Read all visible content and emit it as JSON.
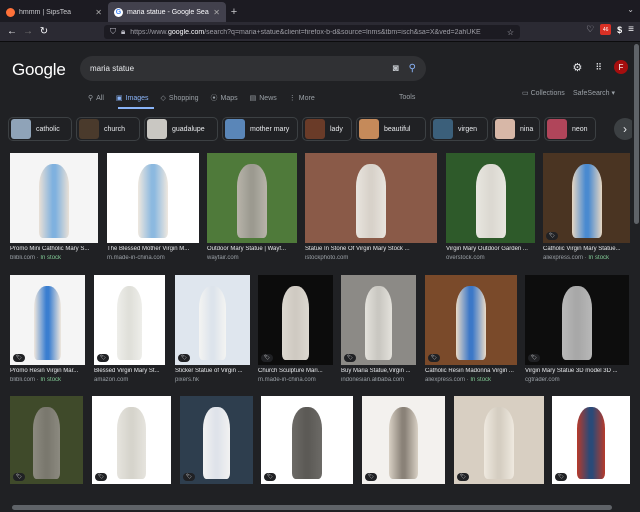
{
  "browser": {
    "tabs": [
      {
        "title": "hmmm | SipsTea",
        "active": false,
        "favicon_color": "#ff7139"
      },
      {
        "title": "maria statue - Google Search",
        "active": true,
        "favicon_color": "#ffffff"
      }
    ],
    "url_prefix": "https://www.",
    "url_domain": "google.com",
    "url_rest": "/search?q=maria+statue&client=firefox-b-d&source=lnms&tbm=isch&sa=X&ved=2ahUKE",
    "new_tab": "+",
    "ext_badge": "46"
  },
  "google": {
    "logo": "Google",
    "search_value": "maria statue",
    "avatar_letter": "F",
    "nav": [
      "All",
      "Images",
      "Shopping",
      "Maps",
      "News",
      "More"
    ],
    "nav_active": 1,
    "tools": "Tools",
    "collections": "Collections",
    "safesearch": "SafeSearch"
  },
  "chips": [
    {
      "label": "catholic",
      "color": "#8fa3b8"
    },
    {
      "label": "church",
      "color": "#4a3a2c"
    },
    {
      "label": "guadalupe",
      "color": "#c9c7c2"
    },
    {
      "label": "mother mary",
      "color": "#5a86b8"
    },
    {
      "label": "lady",
      "color": "#6a3b28"
    },
    {
      "label": "beautiful",
      "color": "#c58a5a"
    },
    {
      "label": "virgen",
      "color": "#3b5f7a"
    },
    {
      "label": "nina",
      "color": "#d7b7a7"
    },
    {
      "label": "neon",
      "color": "#b0455a"
    }
  ],
  "results": [
    {
      "caption": "Promo Mini Catholic Mary S...",
      "source": "blibli.com",
      "stock": "In stock"
    },
    {
      "caption": "The Blessed Mother Virgin M...",
      "source": "m.made-in-china.com"
    },
    {
      "caption": "Outdoor Mary Statue | Wayf...",
      "source": "wayfair.com"
    },
    {
      "caption": "Statue In Stone Of Virgin Mary Stock ...",
      "source": "istockphoto.com"
    },
    {
      "caption": "Virgin Mary Outdoor Garden ...",
      "source": "overstock.com"
    },
    {
      "caption": "Catholic Virgin Mary Statue...",
      "source": "aliexpress.com",
      "stock": "In stock"
    },
    {
      "caption": "Promo Resin Virgin Mar...",
      "source": "blibli.com",
      "stock": "In stock"
    },
    {
      "caption": "Blessed Virgin Mary St...",
      "source": "amazon.com"
    },
    {
      "caption": "Sticker Statue of Virgin ...",
      "source": "pixers.hk"
    },
    {
      "caption": "Church Sculpture Mari...",
      "source": "m.made-in-china.com"
    },
    {
      "caption": "Buy Maria Statue,Virgin ...",
      "source": "indonesian.alibaba.com"
    },
    {
      "caption": "Catholic Resin Madonna Virgin ...",
      "source": "aliexpress.com",
      "stock": "In stock"
    },
    {
      "caption": "Virgin Mary Statue 3D model 3D ...",
      "source": "cgtrader.com"
    },
    {
      "caption": "",
      "source": ""
    },
    {
      "caption": "",
      "source": ""
    },
    {
      "caption": "",
      "source": ""
    },
    {
      "caption": "",
      "source": ""
    },
    {
      "caption": "",
      "source": ""
    },
    {
      "caption": "",
      "source": ""
    },
    {
      "caption": "",
      "source": ""
    }
  ]
}
